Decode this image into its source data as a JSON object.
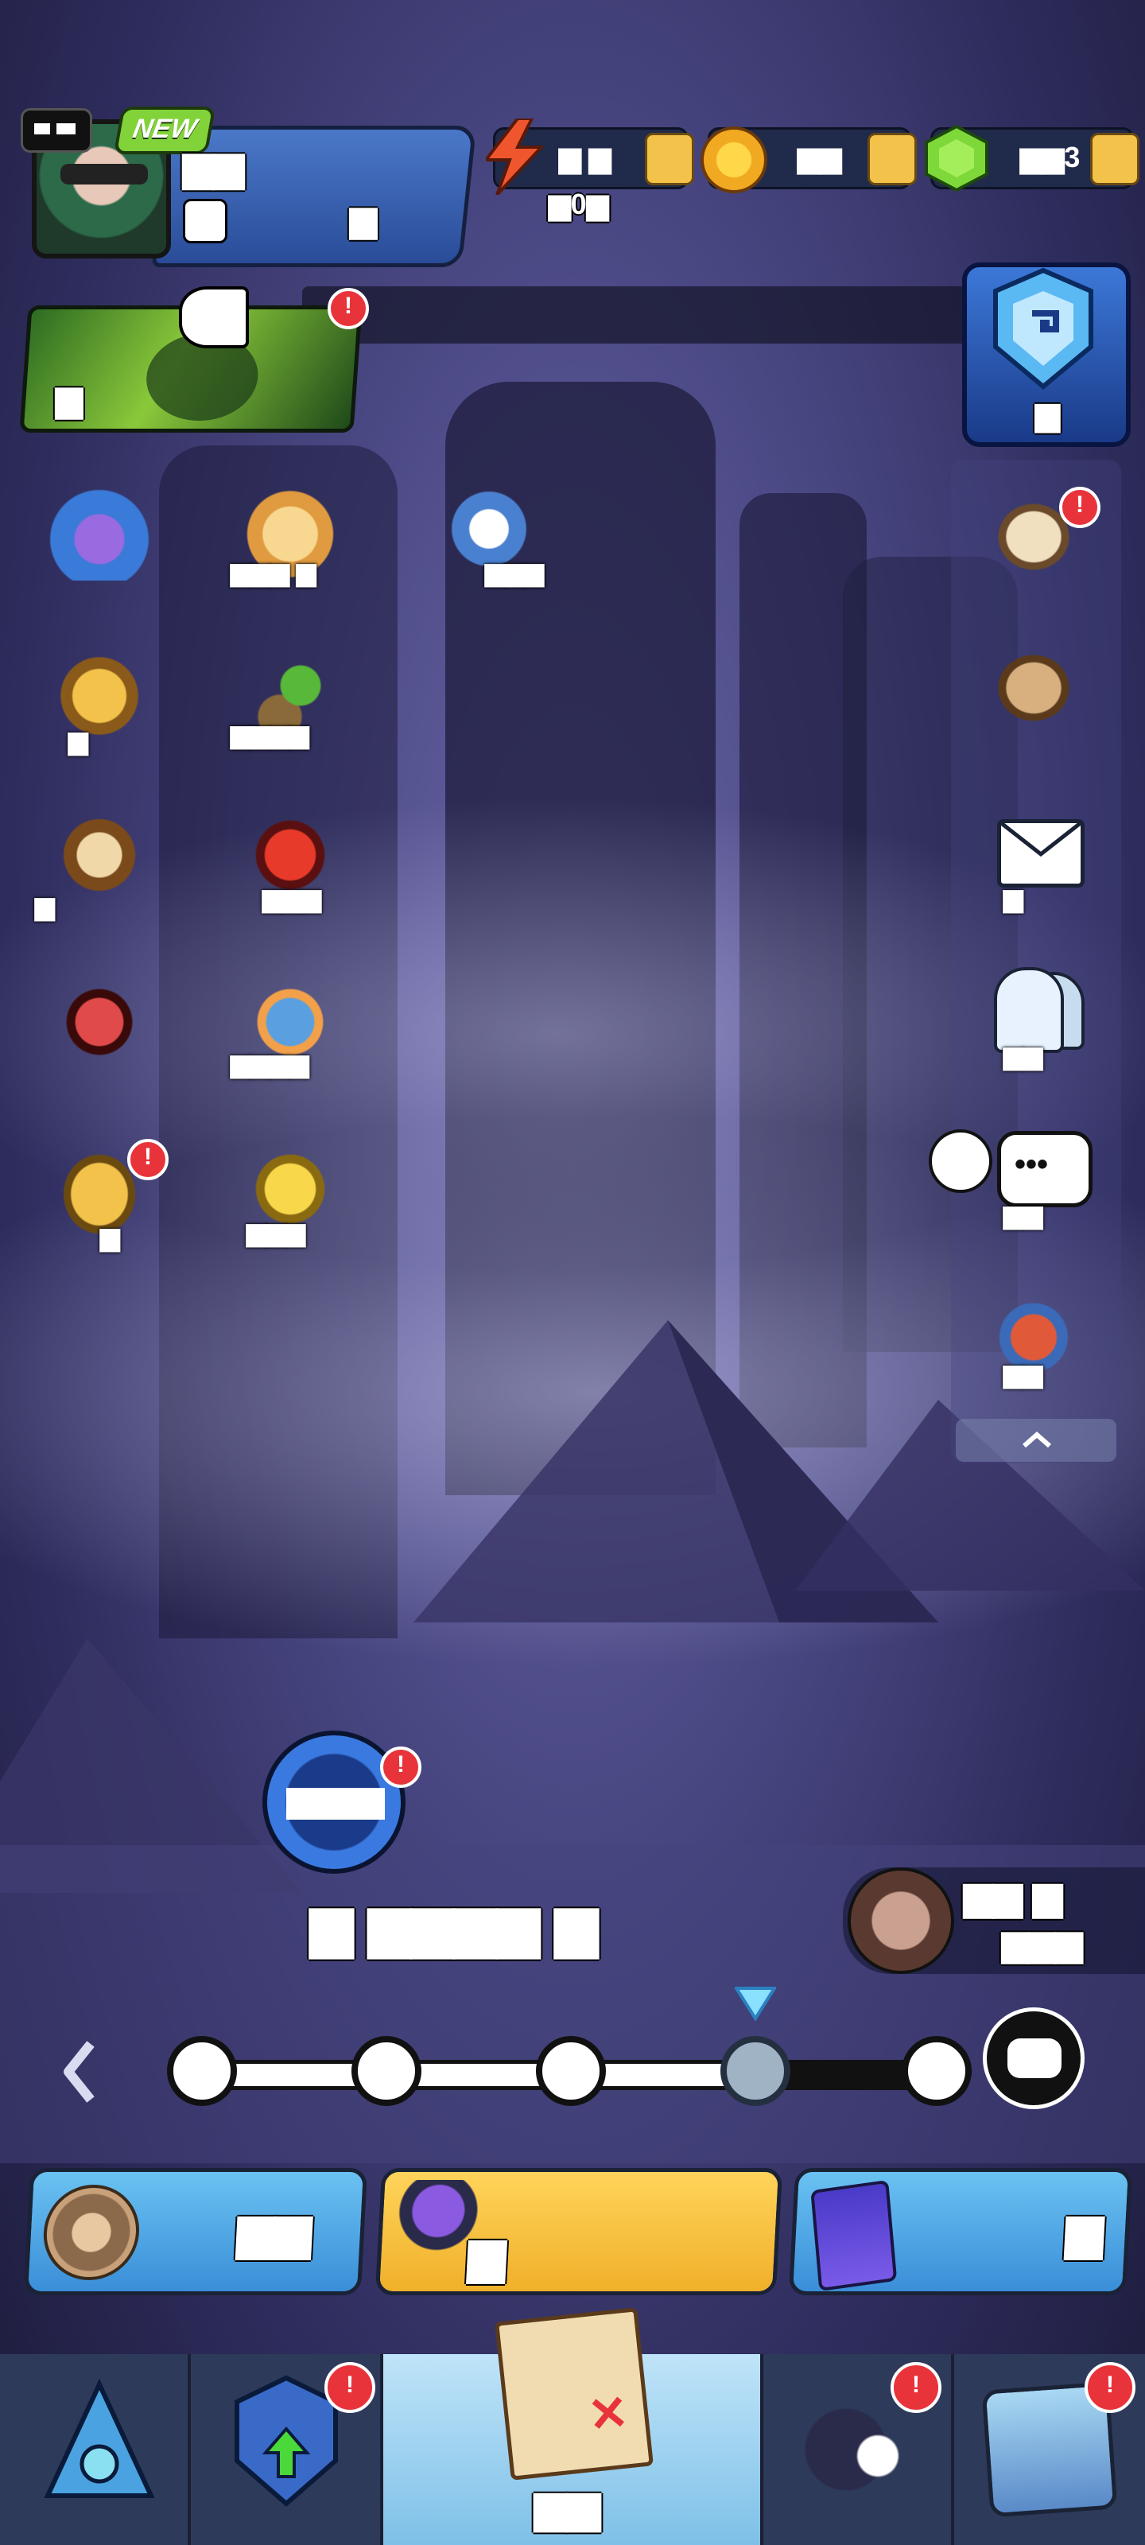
{
  "player": {
    "new_badge": "NEW",
    "name": "▆▆",
    "level": "▆"
  },
  "resources": {
    "energy_value": "▆ ▆",
    "energy_timer": "▆0▆",
    "gold_value": "▆▆",
    "gems_value": "▆▆3"
  },
  "announcement": {
    "banner_label": "▆"
  },
  "rank_badge_label": "▆",
  "left_icons": [
    {
      "name": "treasure-chest",
      "label": ""
    },
    {
      "name": "birthday-cake",
      "label": "▆▆▆ ▆"
    },
    {
      "name": "event-pass",
      "label": "▆▆▆"
    },
    {
      "name": "gold-chest",
      "label": "▆"
    },
    {
      "name": "palm-island",
      "label": "▆▆▆▆"
    },
    {
      "name": "quest-clipboard",
      "label": "▆"
    },
    {
      "name": "red-dragon",
      "label": "▆▆▆"
    },
    {
      "name": "battle-arena",
      "label": "▆▆▆▆"
    },
    {
      "name": "unicorn-pet",
      "label": ""
    },
    {
      "name": "golden-pig",
      "label": "▆"
    },
    {
      "name": "gold-card",
      "label": "▆▆▆"
    }
  ],
  "side_panel": [
    {
      "name": "scroll",
      "label": ""
    },
    {
      "name": "backpack",
      "label": ""
    },
    {
      "name": "mail",
      "label": "▆"
    },
    {
      "name": "friends",
      "label": "▆▆"
    },
    {
      "name": "chat",
      "label": "▆▆"
    },
    {
      "name": "potion-shop",
      "label": "▆▆"
    }
  ],
  "stage": {
    "portal_label": "▆▆▆",
    "stage_title": "▆ ▆▆▆▆ ▆",
    "boss_label_1": "▆▆ ▆",
    "boss_label_2": "▆▆▆"
  },
  "actions": {
    "left_label": "▆▆",
    "middle_label": "▆",
    "right_label": "▆"
  },
  "tabs": [
    {
      "name": "tab-castle"
    },
    {
      "name": "tab-upgrade"
    },
    {
      "name": "tab-map",
      "label": "▆▆"
    },
    {
      "name": "tab-heroes"
    },
    {
      "name": "tab-shop"
    }
  ],
  "colors": {
    "accent_blue": "#4aa3e0",
    "accent_yellow": "#f2c24a",
    "badge_red": "#e8333a"
  }
}
